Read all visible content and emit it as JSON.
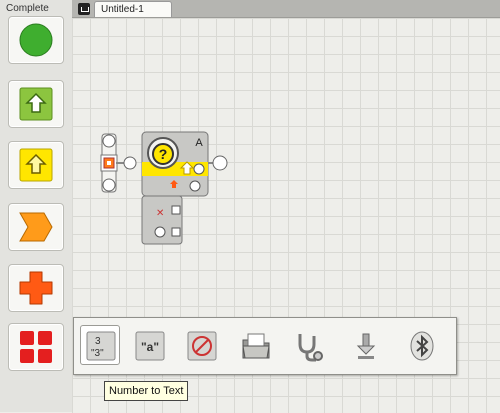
{
  "palette": {
    "title": "Complete",
    "items": [
      {
        "icon": "circle-icon",
        "color": "#3fae2f"
      },
      {
        "icon": "up-arrow-icon",
        "color": "#8cc53f"
      },
      {
        "icon": "up-arrow-icon",
        "color": "#ffe600"
      },
      {
        "icon": "parallelogram-icon",
        "color": "#ff9b1a"
      },
      {
        "icon": "cross-icon",
        "color": "#ff5a14"
      },
      {
        "icon": "grid-icon",
        "color": "#e41f1f"
      }
    ]
  },
  "tab": {
    "title": "Untitled-1"
  },
  "block": {
    "port_label": "A"
  },
  "toolbar": {
    "tools": [
      {
        "name": "number-to-text",
        "top": "3",
        "bottom": "\"3\""
      },
      {
        "name": "text",
        "label": "\"a\""
      },
      {
        "name": "stop"
      },
      {
        "name": "file-access"
      },
      {
        "name": "calibrate"
      },
      {
        "name": "reset-motor"
      },
      {
        "name": "bluetooth-connection"
      }
    ]
  },
  "tooltip": {
    "text": "Number to Text"
  }
}
